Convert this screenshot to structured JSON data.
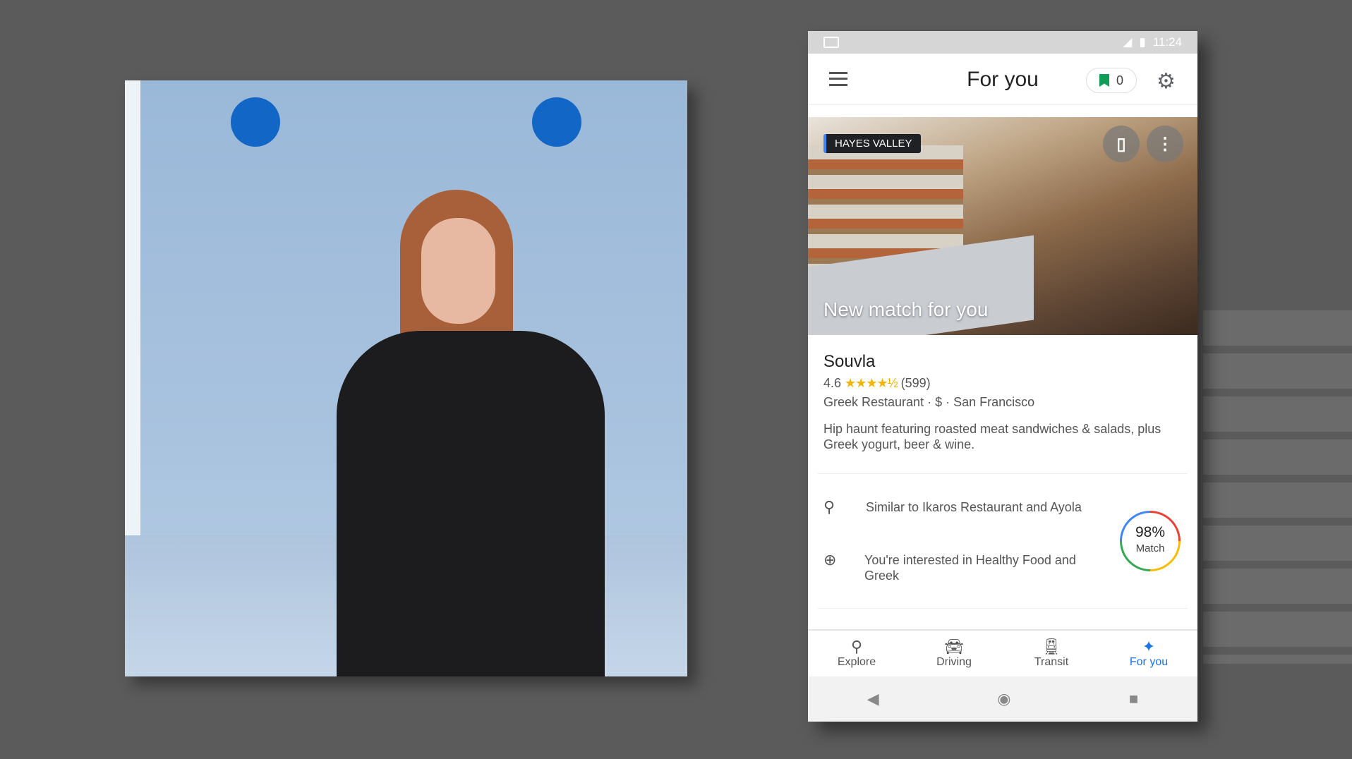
{
  "status_bar": {
    "time": "11:24"
  },
  "header": {
    "title": "For you",
    "saved_count": "0"
  },
  "hero": {
    "neighborhood": "HAYES VALLEY",
    "caption": "New match for you"
  },
  "place": {
    "name": "Souvla",
    "rating": "4.6",
    "stars": "★★★★½",
    "reviews": "(599)",
    "category": "Greek Restaurant · $ · San Francisco",
    "description": "Hip haunt featuring roasted meat sandwiches & salads, plus Greek yogurt, beer & wine."
  },
  "reasons": [
    {
      "icon": "location-pin-icon",
      "text": "Similar to Ikaros Restaurant and Ayola"
    },
    {
      "icon": "trending-up-icon",
      "text": "You're interested in Healthy Food and Greek"
    }
  ],
  "match": {
    "percent": "98%",
    "label": "Match"
  },
  "bottom_nav": [
    {
      "label": "Explore"
    },
    {
      "label": "Driving"
    },
    {
      "label": "Transit"
    },
    {
      "label": "For you",
      "active": true
    }
  ],
  "colors": {
    "accent": "#1a73e8",
    "star": "#f4b400",
    "saved": "#0f9d58"
  }
}
